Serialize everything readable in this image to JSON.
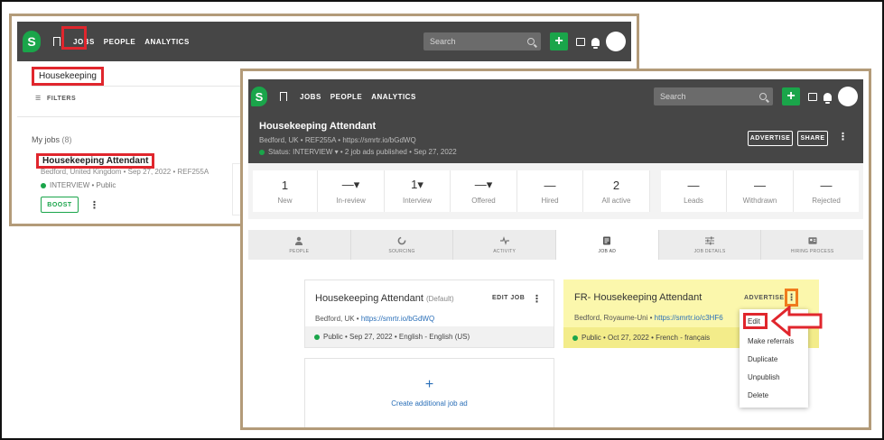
{
  "nav": {
    "logo": "S",
    "links": [
      "JOBS",
      "PEOPLE",
      "ANALYTICS"
    ],
    "search_placeholder": "Search",
    "plus": "+"
  },
  "list_view": {
    "search_value": "Housekeeping",
    "search_clear": "×",
    "filters_label": "FILTERS",
    "my_jobs_label": "My jobs",
    "my_jobs_count": "(8)",
    "job": {
      "title": "Housekeeping Attendant",
      "meta": "Bedford, United Kingdom  •  Sep 27, 2022  •  REF255A",
      "status": "INTERVIEW  •  Public",
      "boost_label": "BOOST",
      "more": "⋮"
    }
  },
  "job_detail": {
    "title": "Housekeeping Attendant",
    "meta": "Bedford, UK  •  REF255A  •  https://smrtr.io/bGdWQ",
    "status": "Status:  INTERVIEW ▾  •  2 job ads published  •  Sep 27, 2022",
    "advertise_label": "ADVERTISE",
    "share_label": "SHARE",
    "more": "⋮",
    "stats": [
      {
        "num": "1",
        "label": "New"
      },
      {
        "num": "—▾",
        "label": "In-review"
      },
      {
        "num": "1▾",
        "label": "Interview"
      },
      {
        "num": "—▾",
        "label": "Offered"
      },
      {
        "num": "—",
        "label": "Hired"
      },
      {
        "num": "2",
        "label": "All active"
      },
      {
        "num": "—",
        "label": "Leads"
      },
      {
        "num": "—",
        "label": "Withdrawn"
      },
      {
        "num": "—",
        "label": "Rejected"
      }
    ],
    "tabs": [
      "PEOPLE",
      "SOURCING",
      "ACTIVITY",
      "JOB AD",
      "JOB DETAILS",
      "HIRING PROCESS"
    ],
    "active_tab": "JOB AD",
    "ad_default": {
      "title": "Housekeeping Attendant",
      "tag": "(Default)",
      "edit_label": "EDIT JOB",
      "more": "⋮",
      "location": "Bedford, UK  •",
      "link": "https://smrtr.io/bGdWQ",
      "footer": "Public  •  Sep 27, 2022  •  English - English (US)"
    },
    "ad_fr": {
      "title": "FR- Housekeeping Attendant",
      "advertise_label": "ADVERTISE",
      "more": "⋮",
      "location": "Bedford, Royaume-Uni  •",
      "link": "https://smrtr.io/c3HF6",
      "footer": "Public  •  Oct 27, 2022  •  French - français"
    },
    "menu": [
      "Edit",
      "Make referrals",
      "Duplicate",
      "Unpublish",
      "Delete"
    ],
    "create": {
      "plus": "+",
      "label": "Create additional job ad"
    }
  },
  "colors": {
    "brand_green": "#1aa54a",
    "header_dark": "#464646",
    "highlight_red": "#e0262d",
    "highlight_orange": "#f07b1d",
    "frame_tan": "#b39b79",
    "highlight_yellow": "#fbf7ac",
    "link_blue": "#2a6fb8"
  }
}
